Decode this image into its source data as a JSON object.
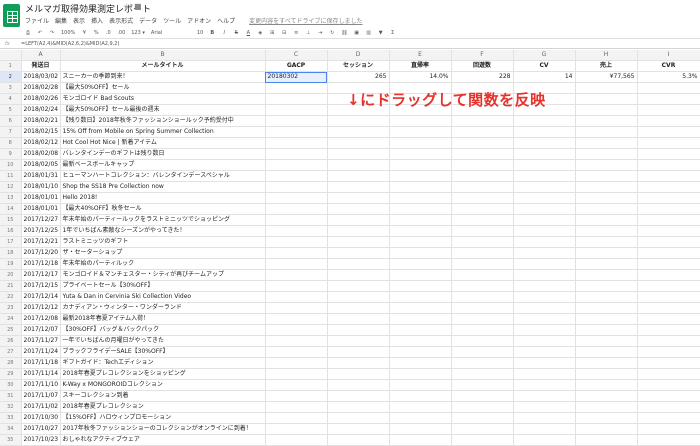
{
  "app": {
    "doc_title": "メルマガ取得効果測定レポート",
    "star_icon": "☆",
    "folder_icon": "■",
    "menus": [
      "ファイル",
      "編集",
      "表示",
      "挿入",
      "表示形式",
      "データ",
      "ツール",
      "アドオン",
      "ヘルプ"
    ],
    "save_status": "変更内容をすべてドライブに保存しました"
  },
  "toolbar": {
    "zoom": "100%",
    "currency": "¥",
    "percent": "%",
    "decimals": ".0",
    "decimals2": ".00",
    "number_format": "123 ▾",
    "font": "Arial",
    "font_size": "10",
    "bold": "B",
    "italic": "I",
    "strike": "S",
    "text_color": "A"
  },
  "formula_bar": {
    "fx": "fx",
    "formula": "=LEFT(A2,4)&MID(A2,6,2)&MID(A2,9,2)"
  },
  "columns": [
    "",
    "A",
    "B",
    "C",
    "D",
    "E",
    "F",
    "G",
    "H",
    "I"
  ],
  "header_row": [
    "発送日",
    "メールタイトル",
    "GACP",
    "セッション",
    "直帰率",
    "回遊数",
    "CV",
    "売上",
    "CVR"
  ],
  "row2": {
    "c": "20180302",
    "d": "265",
    "e": "14.0%",
    "f": "228",
    "g": "14",
    "h": "¥77,565",
    "i": "5.3%"
  },
  "rows": [
    [
      "2018/03/02",
      "スニーカーの季節到来！"
    ],
    [
      "2018/02/28",
      "【最大50%OFF】セール"
    ],
    [
      "2018/02/26",
      "モンゴロイド Bad Scouts"
    ],
    [
      "2018/02/24",
      "【最大50%OFF】セール最後の週末"
    ],
    [
      "2018/02/21",
      "【残り数日】2018年秋冬ファッションショールック予約受付中"
    ],
    [
      "2018/02/15",
      "15% Off from Mobile on Spring Summer Collection"
    ],
    [
      "2018/02/12",
      "Hot Cool Hot Nice | 新着アイテム"
    ],
    [
      "2018/02/08",
      "バレンタインデーのギフトは残り数日"
    ],
    [
      "2018/02/05",
      "最新ベースボールキャップ"
    ],
    [
      "2018/01/31",
      "ヒューマンハートコレクション：バレンタインデースペシャル"
    ],
    [
      "2018/01/10",
      "Shop the SS18 Pre Collection now"
    ],
    [
      "2018/01/01",
      "Hello 2018!"
    ],
    [
      "2018/01/01",
      "【最大40%OFF】秋冬セール"
    ],
    [
      "2017/12/27",
      "年末年始のパーティールックをラストミニッツでショッピング"
    ],
    [
      "2017/12/25",
      "1年でいちばん素敵なシーズンがやってきた！"
    ],
    [
      "2017/12/21",
      "ラストミニッツのギフト"
    ],
    [
      "2017/12/20",
      "ザ・セーターショップ"
    ],
    [
      "2017/12/18",
      "年末年始のパーティルック"
    ],
    [
      "2017/12/17",
      "モンゴロイド＆マンチェスター・シティが再びチームアップ"
    ],
    [
      "2017/12/15",
      "プライベートセール【30%OFF】"
    ],
    [
      "2017/12/14",
      "Yuta & Dan in Cervinia Ski Collection Video"
    ],
    [
      "2017/12/12",
      "カナディアン・ウィンター・ワンダーランド"
    ],
    [
      "2017/12/08",
      "最新2018年春夏アイテム入荷！"
    ],
    [
      "2017/12/07",
      "【30%OFF】バッグ＆バックパック"
    ],
    [
      "2017/11/27",
      "一年でいちばんの月曜日がやってきた"
    ],
    [
      "2017/11/24",
      "ブラックフライデーSALE【30%OFF】"
    ],
    [
      "2017/11/18",
      "ギフトガイド：Techエディション"
    ],
    [
      "2017/11/14",
      "2018年春夏プレコレクションをショッピング"
    ],
    [
      "2017/11/10",
      "K-Way x MONGOROIDコレクション"
    ],
    [
      "2017/11/07",
      "スキーコレクション到着"
    ],
    [
      "2017/11/02",
      "2018年春夏プレコレクション"
    ],
    [
      "2017/10/30",
      "【15%OFF】ハロウィンプロモーション"
    ],
    [
      "2017/10/27",
      "2017年秋冬ファッションショーのコレクションがオンラインに到着！"
    ],
    [
      "2017/10/23",
      "おしゃれなアクティブウェア"
    ]
  ],
  "annotation": "↓にドラッグして関数を反映"
}
